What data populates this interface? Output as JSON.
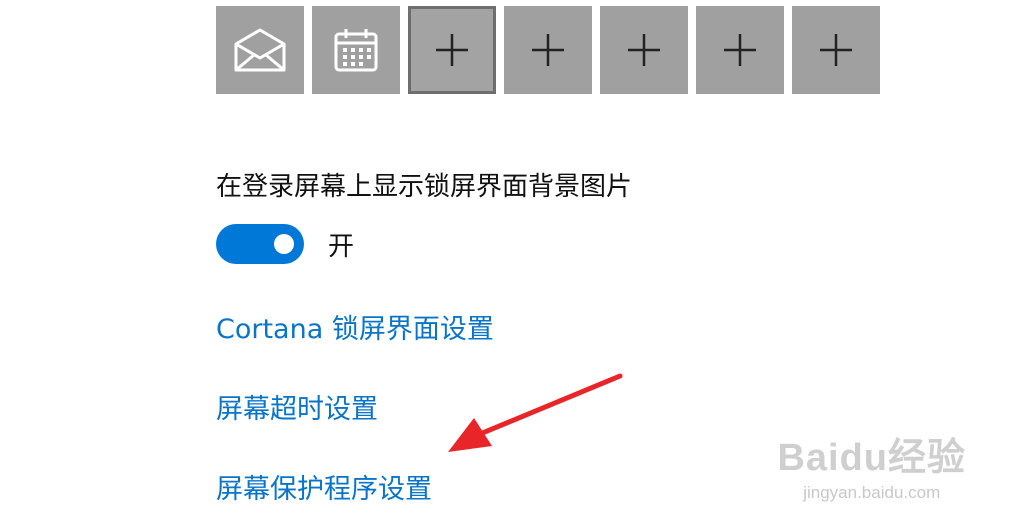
{
  "quick_status_apps": [
    {
      "icon": "mail-icon"
    },
    {
      "icon": "calendar-icon"
    },
    {
      "icon": "plus-icon"
    },
    {
      "icon": "plus-icon"
    },
    {
      "icon": "plus-icon"
    },
    {
      "icon": "plus-icon"
    },
    {
      "icon": "plus-icon"
    }
  ],
  "login_background": {
    "label": "在登录屏幕上显示锁屏界面背景图片",
    "toggle_state": "开",
    "toggle_on": true,
    "accent_color": "#0078d7"
  },
  "links": {
    "cortana": "Cortana 锁屏界面设置",
    "screen_timeout": "屏幕超时设置",
    "screen_saver": "屏幕保护程序设置"
  },
  "annotation": {
    "arrow_color": "#e8262a"
  },
  "watermark": {
    "main": "Baidu经验",
    "sub": "jingyan.baidu.com"
  }
}
